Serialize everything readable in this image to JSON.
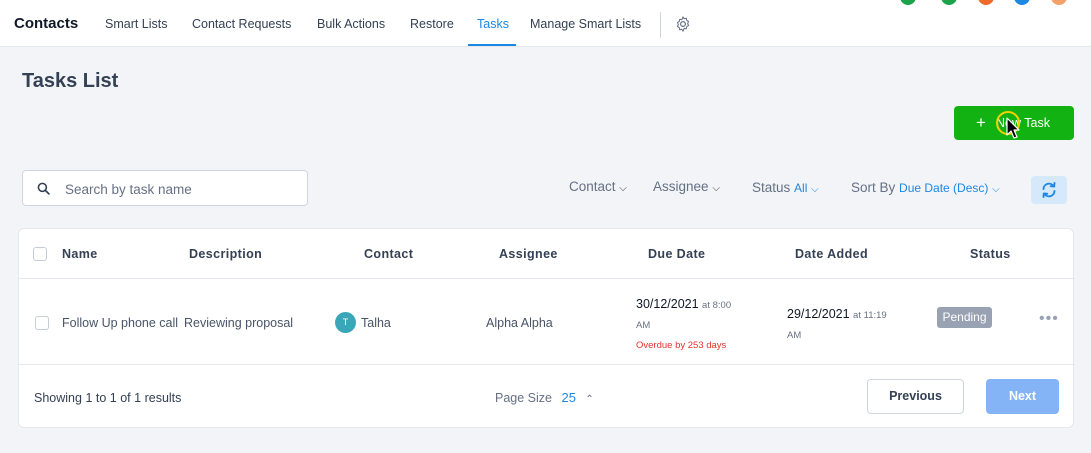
{
  "nav": {
    "brand": "Contacts",
    "items": [
      {
        "label": "Smart Lists"
      },
      {
        "label": "Contact Requests"
      },
      {
        "label": "Bulk Actions"
      },
      {
        "label": "Restore"
      },
      {
        "label": "Tasks"
      },
      {
        "label": "Manage Smart Lists"
      }
    ],
    "active": "Tasks"
  },
  "page": {
    "title": "Tasks List",
    "new_task_label": "New Task"
  },
  "filters": {
    "search_placeholder": "Search by task name",
    "contact_label": "Contact",
    "assignee_label": "Assignee",
    "status_label": "Status",
    "status_value": "All",
    "sort_label": "Sort By",
    "sort_value": "Due Date (Desc)"
  },
  "table": {
    "headers": [
      "Name",
      "Description",
      "Contact",
      "Assignee",
      "Due Date",
      "Date Added",
      "Status"
    ],
    "rows": [
      {
        "name": "Follow Up phone call",
        "description": "Reviewing proposal",
        "contact_initial": "T",
        "contact": "Talha",
        "assignee": "Alpha Alpha",
        "due_date": "30/12/2021",
        "due_time_line1": "at 8:00",
        "due_time_line2": "AM",
        "overdue": "Overdue by 253 days",
        "date_added": "29/12/2021",
        "added_time_line1": "at 11:19",
        "added_time_line2": "AM",
        "status": "Pending"
      }
    ]
  },
  "footer": {
    "showing_prefix": "Showing",
    "showing_from": "1",
    "showing_to_word": "to",
    "showing_to": "1",
    "showing_of_word": "of",
    "showing_total": "1",
    "showing_suffix": "results",
    "page_size_label": "Page Size",
    "page_size_value": "25",
    "previous_label": "Previous",
    "next_label": "Next"
  },
  "colors": {
    "accent": "#1d87e4",
    "new_task_green": "#12b212",
    "pending_badge": "#98a2b3",
    "overdue_red": "#e5322d"
  }
}
